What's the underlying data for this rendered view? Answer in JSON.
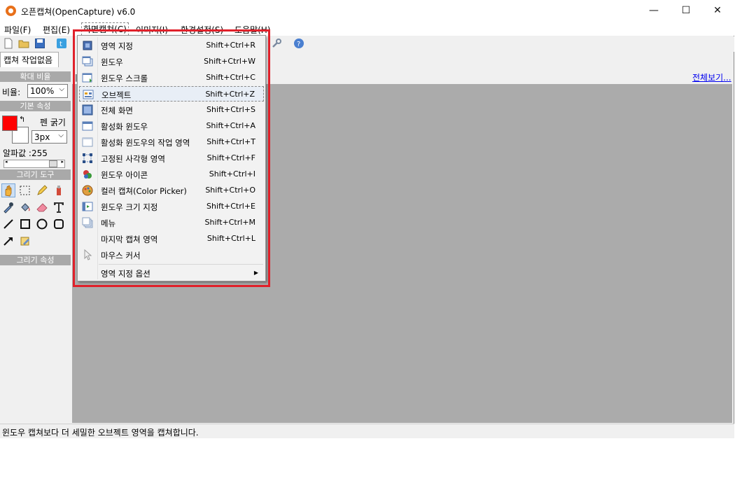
{
  "window": {
    "title": "오픈캡쳐(OpenCapture) v6.0",
    "minimize": "—",
    "maximize": "☐",
    "close": "✕"
  },
  "menubar": [
    "파일(F)",
    "편집(E)",
    "화면캡쳐(C)",
    "이미지(I)",
    "환경설정(S)",
    "도움말(H)"
  ],
  "tab": "캡쳐 작업없음",
  "view_all": "전체보기...",
  "sidebar": {
    "zoom_header": "확대 비율",
    "zoom_label": "비율:",
    "zoom_value": "100%",
    "basic_header": "기본 속성",
    "pen_label": "펜 굵기",
    "pen_value": "3px",
    "alpha_label": "알파값 :255",
    "draw_tools_header": "그리기 도구",
    "draw_props_header": "그리기 속성",
    "fg_color": "#ff0000",
    "bg_color": "#ffffff",
    "tools": [
      "hand-icon",
      "rect-select-icon",
      "pencil-icon",
      "highlighter-icon",
      "eyedropper-icon",
      "fill-bucket-icon",
      "eraser-icon",
      "text-icon",
      "line-icon",
      "rectangle-icon",
      "ellipse-icon",
      "rounded-rect-icon",
      "arrow-icon",
      "note-icon"
    ]
  },
  "capture_menu": [
    {
      "label": "영역 지정",
      "shortcut": "Shift+Ctrl+R",
      "icon": "region-icon"
    },
    {
      "label": "윈도우",
      "shortcut": "Shift+Ctrl+W",
      "icon": "window-icon"
    },
    {
      "label": "윈도우 스크롤",
      "shortcut": "Shift+Ctrl+C",
      "icon": "window-scroll-icon"
    },
    {
      "label": "오브젝트",
      "shortcut": "Shift+Ctrl+Z",
      "icon": "object-icon",
      "highlighted": true
    },
    {
      "label": "전체 화면",
      "shortcut": "Shift+Ctrl+S",
      "icon": "fullscreen-icon"
    },
    {
      "label": "활성화 윈도우",
      "shortcut": "Shift+Ctrl+A",
      "icon": "active-window-icon"
    },
    {
      "label": "활성화 윈도우의 작업 영역",
      "shortcut": "Shift+Ctrl+T",
      "icon": "client-area-icon"
    },
    {
      "label": "고정된 사각형 영역",
      "shortcut": "Shift+Ctrl+F",
      "icon": "fixed-rect-icon"
    },
    {
      "label": "윈도우 아이콘",
      "shortcut": "Shift+Ctrl+I",
      "icon": "window-icon-capture-icon"
    },
    {
      "label": "컬러 캡쳐(Color Picker)",
      "shortcut": "Shift+Ctrl+O",
      "icon": "color-picker-icon"
    },
    {
      "label": "윈도우 크기 지정",
      "shortcut": "Shift+Ctrl+E",
      "icon": "window-size-icon"
    },
    {
      "label": "메뉴",
      "shortcut": "Shift+Ctrl+M",
      "icon": "menu-capture-icon"
    },
    {
      "label": "마지막 캡쳐 영역",
      "shortcut": "Shift+Ctrl+L",
      "icon": "last-region-icon"
    },
    {
      "label": "마우스 커서",
      "shortcut": "",
      "icon": "cursor-icon"
    }
  ],
  "submenu": {
    "label": "영역 지정 옵션",
    "arrow": "▶"
  },
  "status": "윈도우 캡쳐보다 더 세밀한 오브젝트 영역을 캡쳐합니다.",
  "colors": {
    "highlight_box": "#e0202a",
    "canvas": "#ababab",
    "section_header": "#a9a9a9"
  }
}
